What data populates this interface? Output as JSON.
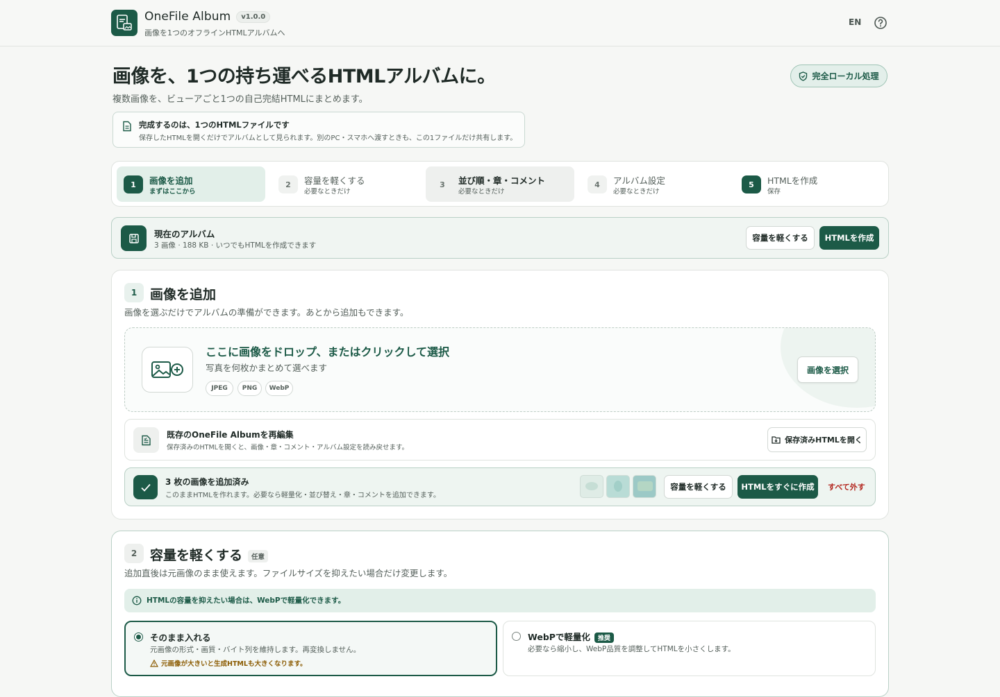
{
  "header": {
    "app_name": "OneFile Album",
    "version": "v1.0.0",
    "tagline": "画像を1つのオフラインHTMLアルバムへ",
    "lang": "EN"
  },
  "hero": {
    "title": "画像を、1つの持ち運べるHTMLアルバムに。",
    "subtitle": "複数画像を、ビューアごと1つの自己完結HTMLにまとめます。",
    "badge": "完全ローカル処理",
    "notice_title": "完成するのは、1つのHTMLファイルです",
    "notice_text": "保存したHTMLを開くだけでアルバムとして見られます。別のPC・スマホへ渡すときも、この1ファイルだけ共有します。"
  },
  "steps": [
    {
      "num": "1",
      "title": "画像を追加",
      "sub": "まずはここから"
    },
    {
      "num": "2",
      "title": "容量を軽くする",
      "sub": "必要なときだけ"
    },
    {
      "num": "3",
      "title": "並び順・章・コメント",
      "sub": "必要なときだけ"
    },
    {
      "num": "4",
      "title": "アルバム設定",
      "sub": "必要なときだけ"
    },
    {
      "num": "5",
      "title": "HTMLを作成",
      "sub": "保存"
    }
  ],
  "album": {
    "title": "現在のアルバム",
    "status": "3 画像 · 188 KB · いつでもHTMLを作成できます",
    "lighten_button": "容量を軽くする",
    "create_button": "HTMLを作成"
  },
  "section1": {
    "num": "1",
    "title": "画像を追加",
    "subtitle": "画像を選ぶだけでアルバムの準備ができます。あとから追加もできます。",
    "drop_title": "ここに画像をドロップ、またはクリックして選択",
    "drop_sub": "写真を何枚かまとめて選べます",
    "formats": [
      "JPEG",
      "PNG",
      "WebP"
    ],
    "select_button": "画像を選択",
    "reedit_title": "既存のOneFile Albumを再編集",
    "reedit_sub": "保存済みのHTMLを開くと、画像・章・コメント・アルバム設定を読み戻せます。",
    "open_saved_button": "保存済みHTMLを開く",
    "added_title": "3 枚の画像を追加済み",
    "added_sub": "このままHTMLを作れます。必要なら軽量化・並び替え・章・コメントを追加できます。",
    "thumb_colors": [
      "#dfece6",
      "#b9dcd6",
      "#9cc9c6"
    ],
    "lighten_button": "容量を軽くする",
    "create_now_button": "HTMLをすぐに作成",
    "remove_all": "すべて外す"
  },
  "section2": {
    "num": "2",
    "title": "容量を軽くする",
    "optional": "任意",
    "subtitle": "追加直後は元画像のまま使えます。ファイルサイズを抑えたい場合だけ変更します。",
    "info": "HTMLの容量を抑えたい場合は、WebPで軽量化できます。",
    "option_keep_title": "そのまま入れる",
    "option_keep_sub": "元画像の形式・画質・バイト列を維持します。再変換しません。",
    "option_keep_warn": "元画像が大きいと生成HTMLも大きくなります。",
    "option_webp_title": "WebPで軽量化",
    "option_webp_badge": "推奨",
    "option_webp_sub": "必要なら縮小し、WebP品質を調整してHTMLを小さくします。"
  },
  "colors": {
    "accent": "#1c5a47",
    "accent_light": "#e2efe9",
    "danger": "#b3261e",
    "warning": "#8a5a00"
  }
}
